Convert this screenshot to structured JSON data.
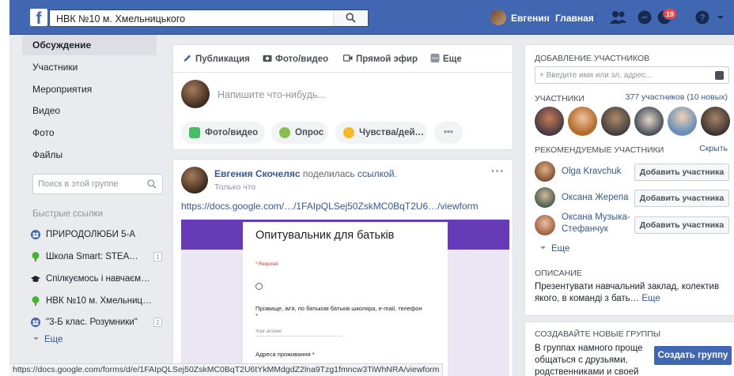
{
  "topbar": {
    "logo": "f",
    "search_value": "НВК №10 м. Хмельницького",
    "user_name": "Евгения",
    "home_label": "Главная",
    "notifications_count": "19",
    "brand_color": "#4267b2"
  },
  "sidebar": {
    "items": [
      {
        "label": "Обсуждение",
        "active": true
      },
      {
        "label": "Участники"
      },
      {
        "label": "Мероприятия"
      },
      {
        "label": "Видео"
      },
      {
        "label": "Фото"
      },
      {
        "label": "Файлы"
      }
    ],
    "group_search_placeholder": "Поиск в этой группе",
    "quick_links_title": "Быстрые ссылки",
    "quick_links": [
      {
        "label": "ПРИРОДОЛЮБИ 5-А",
        "icon": "group-icon",
        "count": ""
      },
      {
        "label": "Школа Smart: STEA…",
        "icon": "tree-icon",
        "count": "1"
      },
      {
        "label": "Спілкуємось і навчаєм…",
        "icon": "graduation-cap-icon",
        "count": ""
      },
      {
        "label": "НВК №10 м. Хмельниц…",
        "icon": "tree-icon",
        "count": ""
      },
      {
        "label": "\"3-Б клас. Розумники\"",
        "icon": "group-icon",
        "count": "2"
      }
    ],
    "more_label": "Еще"
  },
  "composer": {
    "tabs": [
      {
        "label": "Публикация",
        "icon": "pencil-icon"
      },
      {
        "label": "Фото/видео",
        "icon": "camera-icon"
      },
      {
        "label": "Прямой эфир",
        "icon": "live-video-icon"
      },
      {
        "label": "Еще",
        "icon": "more-icon"
      }
    ],
    "placeholder": "Напишите что-нибудь...",
    "chips": [
      {
        "label": "Фото/видео",
        "icon": "photo-icon"
      },
      {
        "label": "Опрос",
        "icon": "poll-icon"
      },
      {
        "label": "Чувства/дей…",
        "icon": "smiley-icon"
      },
      {
        "label": "•••",
        "icon": ""
      }
    ]
  },
  "post": {
    "author": "Евгения Скочеляс",
    "action": "поделилась",
    "object": "ссылкой.",
    "time": "Только что",
    "link": "https://docs.google.com/…/1FAIpQLSej50ZskMC0BqT2U6…/viewform",
    "preview": {
      "title": "Опитувальник для батьків",
      "required_note": "* Required",
      "question1": "Прізвище, ім'я, по батькові батьків школяра, e-mail, телефон",
      "answer_placeholder": "Your answer",
      "question2": "Адреса проживання *",
      "accent_color": "#673ab7"
    }
  },
  "right": {
    "add_members_title": "Добавление участников",
    "add_members_placeholder": "+ Введите имя или эл. адрес...",
    "members_title": "Участники",
    "members_count": "377 участников (10 новых)",
    "recommended_title": "Рекомендуемые участники",
    "hide_label": "Скрыть",
    "recommended": [
      {
        "name": "Olga Kravchuk",
        "button": "Добавить участника"
      },
      {
        "name": "Оксана Жерепа",
        "button": "Добавить участника"
      },
      {
        "name": "Оксана Музыка-Стефанчук",
        "name_line1": "Оксана Музыка-",
        "name_line2": "Стефанчук",
        "button": "Добавить участника"
      }
    ],
    "more_label": "Еще",
    "description_title": "Описание",
    "description_text": "Презентувати навчальний заклад, колектив якого, в команді з бать…",
    "description_more": "Еще",
    "create_group_title": "Создавайте новые группы",
    "create_group_text": "В группах намного проще общаться с друзьями, родственниками и своей",
    "create_group_button": "Создать группу"
  },
  "status_bar": {
    "url": "https://docs.google.com/forms/d/e/1FAIpQLSej50ZskMC0BqT2U6tYkMMdgdZ2lna9Tzg1fmncw3TiWhNRA/viewform"
  }
}
